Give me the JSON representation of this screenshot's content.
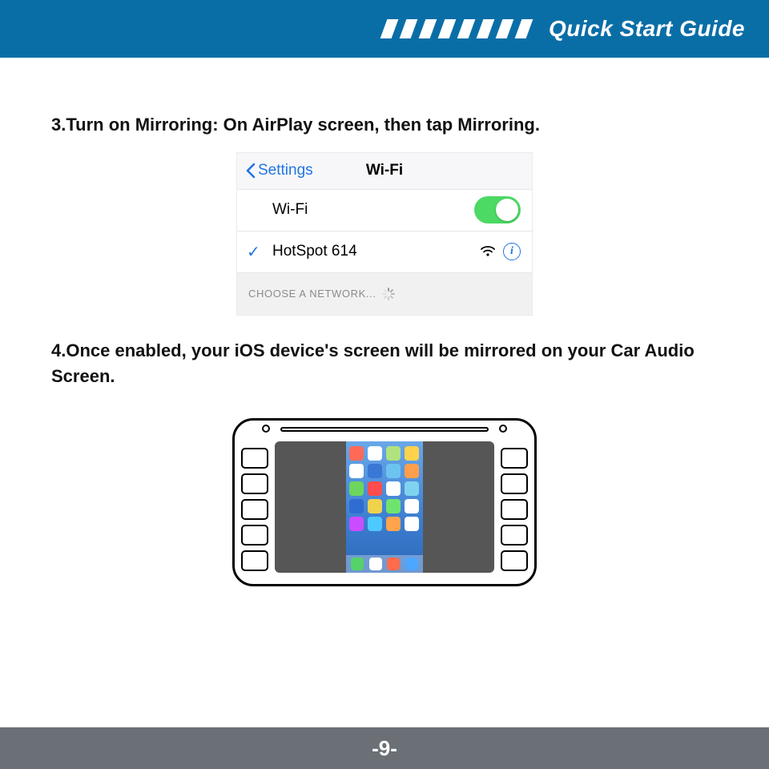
{
  "header": {
    "title": "Quick Start Guide"
  },
  "steps": {
    "s3": "3.Turn on Mirroring: On AirPlay screen, then tap Mirroring.",
    "s4": "4.Once enabled, your iOS device's screen will be mirrored on your Car Audio Screen."
  },
  "ios": {
    "back_label": "Settings",
    "nav_title": "Wi-Fi",
    "wifi_row_label": "Wi-Fi",
    "wifi_on": true,
    "connected_network": "HotSpot 614",
    "choose_label": "CHOOSE A NETWORK..."
  },
  "footer": {
    "page": "-9-"
  },
  "colors": {
    "header_bg": "#0a6ea6",
    "ios_accent": "#2275e2",
    "toggle_on": "#4cd964",
    "footer_bg": "#6b7077"
  }
}
